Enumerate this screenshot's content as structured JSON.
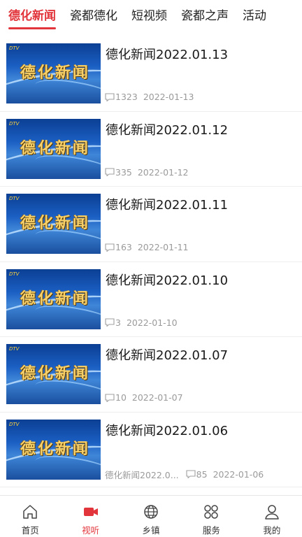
{
  "tabs": [
    {
      "label": "德化新闻",
      "active": true
    },
    {
      "label": "瓷都德化",
      "active": false
    },
    {
      "label": "短视频",
      "active": false
    },
    {
      "label": "瓷都之声",
      "active": false
    },
    {
      "label": "活动",
      "active": false
    }
  ],
  "thumbnail": {
    "logo_text": "德化新闻"
  },
  "news": [
    {
      "title": "德化新闻2022.01.13",
      "source": "",
      "views": "1323",
      "date": "2022-01-13"
    },
    {
      "title": "德化新闻2022.01.12",
      "source": "",
      "views": "335",
      "date": "2022-01-12"
    },
    {
      "title": "德化新闻2022.01.11",
      "source": "",
      "views": "163",
      "date": "2022-01-11"
    },
    {
      "title": "德化新闻2022.01.10",
      "source": "",
      "views": "3",
      "date": "2022-01-10"
    },
    {
      "title": "德化新闻2022.01.07",
      "source": "",
      "views": "10",
      "date": "2022-01-07"
    },
    {
      "title": "德化新闻2022.01.06",
      "source": "德化新闻2022.0...",
      "views": "85",
      "date": "2022-01-06"
    }
  ],
  "bottom_nav": [
    {
      "label": "首页",
      "icon": "home-icon",
      "active": false
    },
    {
      "label": "视听",
      "icon": "video-camera-icon",
      "active": true
    },
    {
      "label": "乡镇",
      "icon": "globe-icon",
      "active": false
    },
    {
      "label": "服务",
      "icon": "grid-circles-icon",
      "active": false
    },
    {
      "label": "我的",
      "icon": "user-icon",
      "active": false
    }
  ],
  "colors": {
    "accent": "#e2343b",
    "meta_text": "#9a9a9a"
  }
}
